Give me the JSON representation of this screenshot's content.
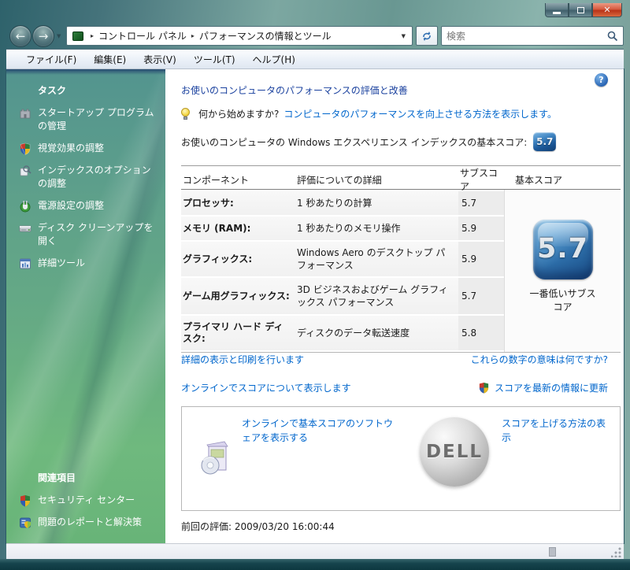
{
  "icons": {
    "back_glyph": "←",
    "forward_glyph": "→",
    "caret_glyph": "▼",
    "breadcrumb_separator": "▸",
    "help_glyph": "?",
    "brand_names": [
      "back-icon",
      "forward-icon",
      "control-panel-icon",
      "refresh-icon",
      "search-icon",
      "help-icon",
      "lightbulb-icon",
      "defender-castle-icon",
      "uac-shield-icon",
      "indexing-search-icon",
      "power-plug-icon",
      "disk-drive-icon",
      "advanced-tools-icon",
      "security-shield-icon",
      "problem-reports-icon",
      "software-box-icon",
      "dell-logo",
      "resize-grip"
    ]
  },
  "navbar": {
    "breadcrumb": [
      {
        "label": "コントロール パネル"
      },
      {
        "label": "パフォーマンスの情報とツール"
      }
    ],
    "search_placeholder": "検索"
  },
  "menubar": {
    "items": [
      {
        "label": "ファイル(F)"
      },
      {
        "label": "編集(E)"
      },
      {
        "label": "表示(V)"
      },
      {
        "label": "ツール(T)"
      },
      {
        "label": "ヘルプ(H)"
      }
    ]
  },
  "sidebar": {
    "tasks_heading": "タスク",
    "tasks": [
      {
        "label": "スタートアップ プログラムの管理"
      },
      {
        "label": "視覚効果の調整"
      },
      {
        "label": "インデックスのオプションの調整"
      },
      {
        "label": "電源設定の調整"
      },
      {
        "label": "ディスク クリーンアップを開く"
      },
      {
        "label": "詳細ツール"
      }
    ],
    "related_heading": "関連項目",
    "related": [
      {
        "label": "セキュリティ センター"
      },
      {
        "label": "問題のレポートと解決策"
      }
    ]
  },
  "main": {
    "title": "お使いのコンピュータのパフォーマンスの評価と改善",
    "hint_prefix": "何から始めますか?",
    "hint_link": "コンピュータのパフォーマンスを向上させる方法を表示します。",
    "base_score_label": "お使いのコンピュータの Windows エクスペリエンス インデックスの基本スコア:",
    "base_score": "5.7",
    "table": {
      "headers": [
        "コンポーネント",
        "評価についての詳細",
        "サブスコア",
        "基本スコア"
      ],
      "rows": [
        {
          "component": "プロセッサ:",
          "detail": "1 秒あたりの計算",
          "subscore": "5.7"
        },
        {
          "component": "メモリ (RAM):",
          "detail": "1 秒あたりのメモリ操作",
          "subscore": "5.9"
        },
        {
          "component": "グラフィックス:",
          "detail": "Windows Aero のデスクトップ パフォーマンス",
          "subscore": "5.9"
        },
        {
          "component": "ゲーム用グラフィックス:",
          "detail": "3D ビジネスおよびゲーム グラフィックス パフォーマンス",
          "subscore": "5.7"
        },
        {
          "component": "プライマリ ハード ディスク:",
          "detail": "ディスクのデータ転送速度",
          "subscore": "5.8"
        }
      ],
      "base_score_value": "5.7",
      "base_score_caption": "一番低いサブスコア"
    },
    "links": {
      "view_print_details": "詳細の表示と印刷を行います",
      "what_do_numbers_mean": "これらの数字の意味は何ですか?",
      "view_scores_online": "オンラインでスコアについて表示します",
      "refresh_score": "スコアを最新の情報に更新"
    },
    "promo": {
      "software_link": "オンラインで基本スコアのソフトウェアを表示する",
      "brand": "DELL",
      "improve_link": "スコアを上げる方法の表示"
    },
    "last_rated": "前回の評価: 2009/03/20 16:00:44"
  },
  "colors": {
    "link_blue": "#0066cc",
    "heading_blue": "#19409e",
    "badge_blue": "#2c6ca7",
    "close_red": "#c33a1f",
    "sidebar_green": "#66ab84"
  }
}
